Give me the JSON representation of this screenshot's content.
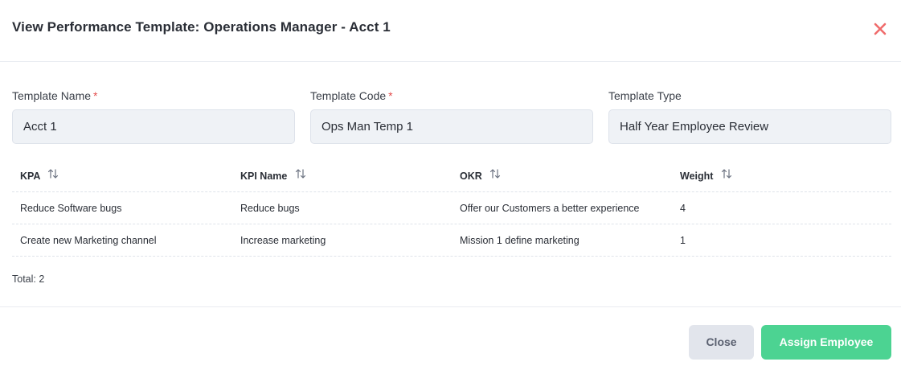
{
  "modal": {
    "title": "View Performance Template: Operations Manager - Acct 1",
    "close_icon": "close-x-icon",
    "close_color": "#f06b6b"
  },
  "form": {
    "template_name": {
      "label": "Template Name",
      "required_mark": "*",
      "value": "Acct 1"
    },
    "template_code": {
      "label": "Template Code",
      "required_mark": "*",
      "value": "Ops Man Temp 1"
    },
    "template_type": {
      "label": "Template Type",
      "value": "Half Year Employee Review"
    }
  },
  "table": {
    "columns": [
      "KPA",
      "KPI Name",
      "OKR",
      "Weight"
    ],
    "sort_icon": "sort-arrows-icon",
    "rows": [
      {
        "kpa": "Reduce Software bugs",
        "kpi": "Reduce bugs",
        "okr": "Offer our Customers a better experience",
        "weight": "4"
      },
      {
        "kpa": "Create new Marketing channel",
        "kpi": "Increase marketing",
        "okr": "Mission 1 define marketing",
        "weight": "1"
      }
    ],
    "total_text": "Total: 2"
  },
  "footer": {
    "close_label": "Close",
    "assign_label": "Assign Employee",
    "assign_color": "#4cd392"
  }
}
